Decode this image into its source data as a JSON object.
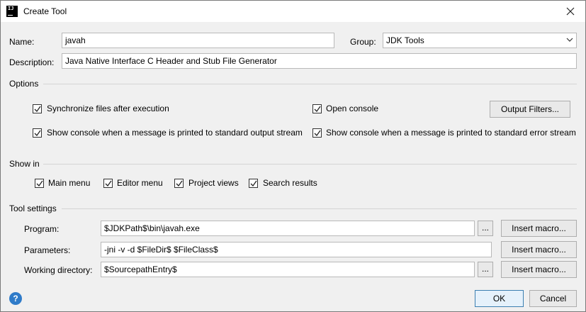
{
  "window": {
    "title": "Create Tool"
  },
  "form": {
    "name_label": "Name:",
    "name_value": "javah",
    "group_label": "Group:",
    "group_value": "JDK Tools",
    "description_label": "Description:",
    "description_value": "Java Native Interface C Header and Stub File Generator"
  },
  "options": {
    "section_label": "Options",
    "sync_files": {
      "label": "Synchronize files after execution",
      "checked": true
    },
    "open_console": {
      "label": "Open console",
      "checked": true
    },
    "output_filters_button": "Output Filters...",
    "show_console_stdout": {
      "label": "Show console when a message is printed to standard output stream",
      "checked": true
    },
    "show_console_stderr": {
      "label": "Show console when a message is printed to standard error stream",
      "checked": true
    }
  },
  "show_in": {
    "section_label": "Show in",
    "main_menu": {
      "label": "Main menu",
      "checked": true
    },
    "editor_menu": {
      "label": "Editor menu",
      "checked": true
    },
    "project_views": {
      "label": "Project views",
      "checked": true
    },
    "search_results": {
      "label": "Search results",
      "checked": true
    }
  },
  "tool_settings": {
    "section_label": "Tool settings",
    "program_label": "Program:",
    "program_value": "$JDKPath$\\bin\\javah.exe",
    "parameters_label": "Parameters:",
    "parameters_value": "-jni -v -d $FileDir$ $FileClass$",
    "working_dir_label": "Working directory:",
    "working_dir_value": "$SourcepathEntry$",
    "browse_label": "...",
    "insert_macro_label": "Insert macro..."
  },
  "footer": {
    "help_label": "?",
    "ok_label": "OK",
    "cancel_label": "Cancel"
  },
  "icons": {
    "app": "intellij-icon",
    "close": "close-icon",
    "dropdown": "chevron-down-icon",
    "help": "help-icon"
  },
  "colors": {
    "accent": "#3c7fb1",
    "help": "#2f7bc9"
  }
}
